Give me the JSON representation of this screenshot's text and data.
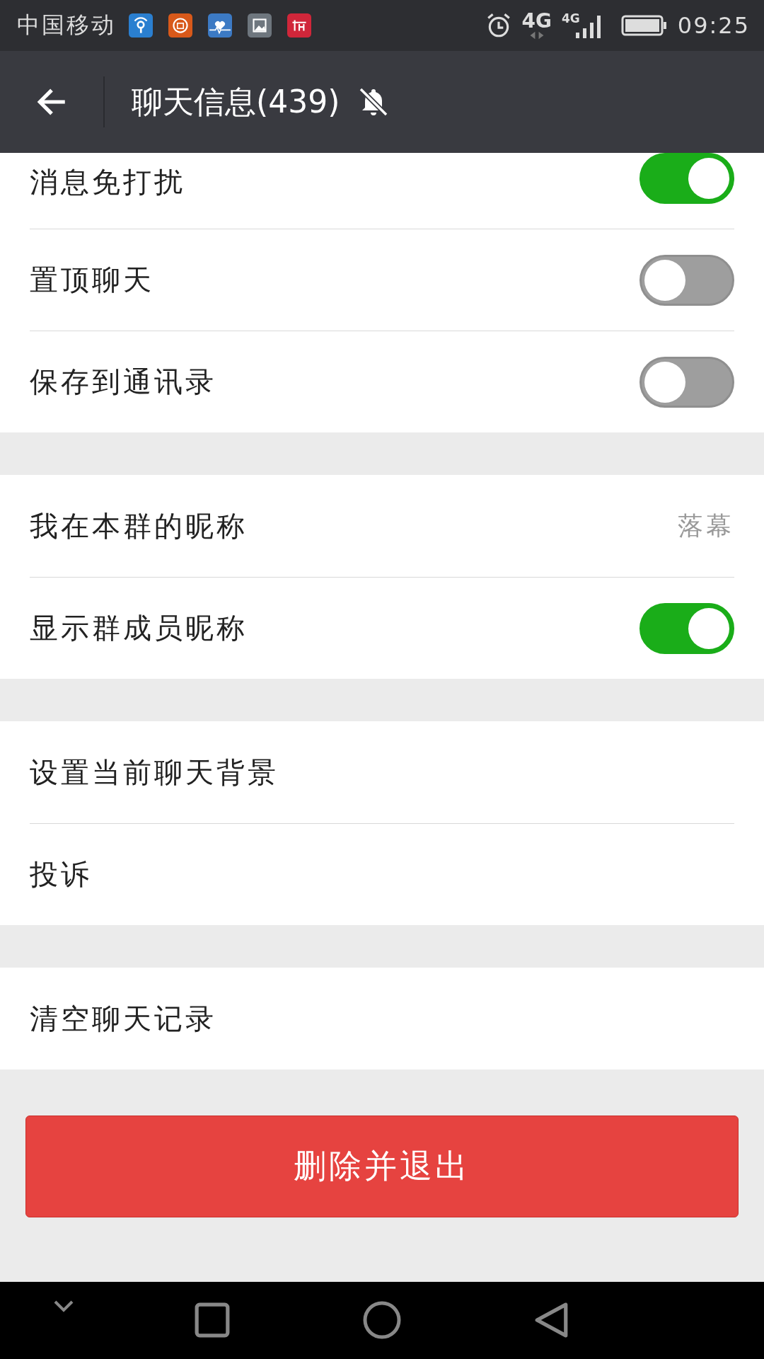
{
  "status_bar": {
    "carrier": "中国移动",
    "time": "09:25",
    "data_type": "4G",
    "signal_type": "4G"
  },
  "toolbar": {
    "title": "聊天信息(439)"
  },
  "sections": [
    {
      "items": [
        {
          "kind": "toggle",
          "label": "消息免打扰",
          "on": true,
          "cut": true
        },
        {
          "kind": "toggle",
          "label": "置顶聊天",
          "on": false
        },
        {
          "kind": "toggle",
          "label": "保存到通讯录",
          "on": false
        }
      ]
    },
    {
      "items": [
        {
          "kind": "value",
          "label": "我在本群的昵称",
          "value": "落幕"
        },
        {
          "kind": "toggle",
          "label": "显示群成员昵称",
          "on": true
        }
      ]
    },
    {
      "items": [
        {
          "kind": "plain",
          "label": "设置当前聊天背景"
        },
        {
          "kind": "plain",
          "label": "投诉"
        }
      ]
    },
    {
      "items": [
        {
          "kind": "plain",
          "label": "清空聊天记录"
        }
      ]
    }
  ],
  "danger_button": {
    "label": "删除并退出"
  }
}
